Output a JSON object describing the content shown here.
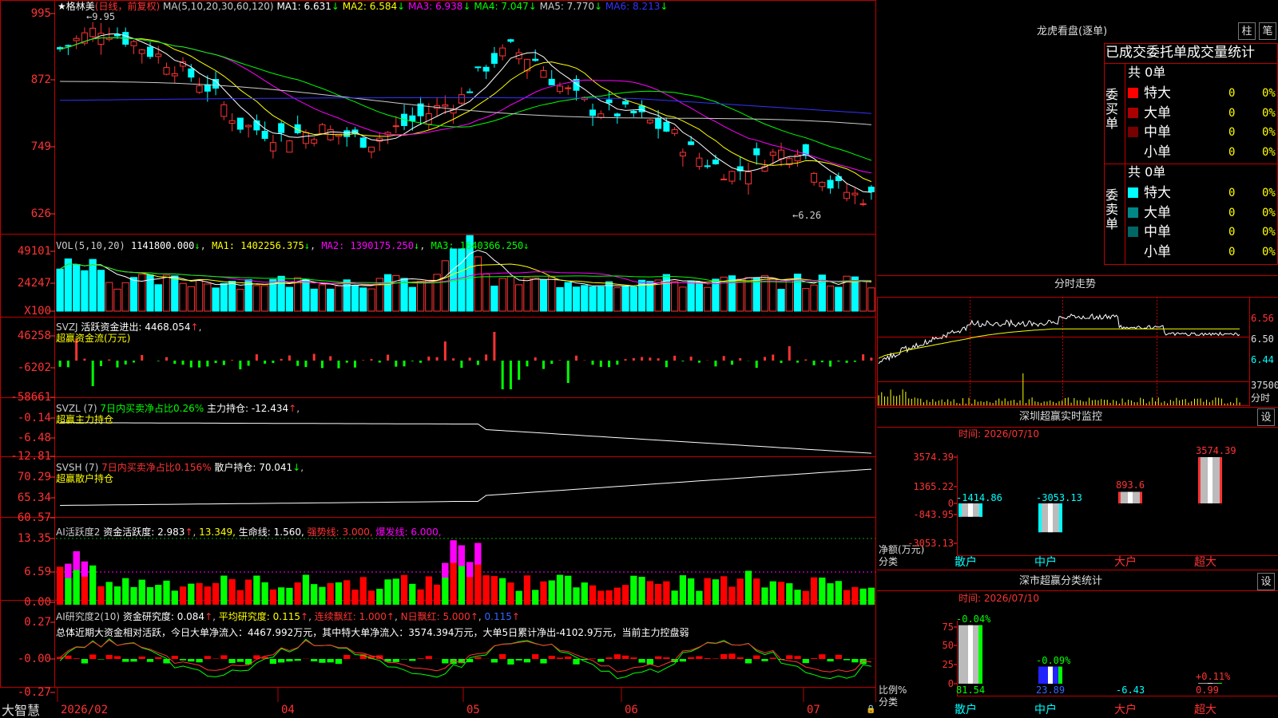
{
  "stock": {
    "name": "格林美",
    "star": "★",
    "period": "(日线，前复权)",
    "ma_params": "MA(5,10,20,30,60,120)",
    "ma": [
      {
        "label": "MA1:",
        "value": "6.631",
        "color": "#ffffff"
      },
      {
        "label": "MA2:",
        "value": "6.584",
        "color": "#ffff00"
      },
      {
        "label": "MA3:",
        "value": "6.938",
        "color": "#ff00ff"
      },
      {
        "label": "MA4:",
        "value": "7.047",
        "color": "#00ff00"
      },
      {
        "label": "MA5:",
        "value": "7.770",
        "color": "#cccccc"
      },
      {
        "label": "MA6:",
        "value": "8.213",
        "color": "#3333ff"
      }
    ],
    "high_mark": "9.95",
    "low_mark": "6.26"
  },
  "axes": {
    "price": [
      "995",
      "872",
      "749",
      "626"
    ],
    "vol": [
      "49101",
      "24247",
      "X100"
    ],
    "svzj": [
      "46258",
      "-6202",
      "-58661"
    ],
    "svzl": [
      "-0.14",
      "-6.48",
      "-12.81"
    ],
    "svsh": [
      "70.29",
      "65.34",
      "60.57"
    ],
    "ai": [
      "13.35",
      "6.59",
      "0.00"
    ],
    "ai2": [
      "0.27",
      "-0.00",
      "-0.27"
    ]
  },
  "vol_panel": {
    "title": "VOL(5,10,20)",
    "value": "1141800.000",
    "ma1": "MA1: 1402256.375",
    "ma2": "MA2: 1390175.250",
    "ma3": "MA3: 1640366.250"
  },
  "svzj_panel": {
    "title": "SVZJ",
    "label": "活跃资金进出: 4468.054",
    "sub": "超赢资金流(万元)"
  },
  "svzl_panel": {
    "title": "SVZL (7)",
    "label1": "7日内买卖净占比0.26%",
    "label2": "主力持仓: -12.434",
    "sub": "超赢主力持仓"
  },
  "svsh_panel": {
    "title": "SVSH (7)",
    "label1": "7日内买卖净占比0.156%",
    "label2": "散户持仓: 70.041",
    "sub": "超赢散户持仓"
  },
  "ai_panel": {
    "title": "AI活跃度2",
    "l1": "资金活跃度: 2.983",
    "l2": "13.349,",
    "l3": "生命线: 1.560,",
    "l4": "强势线: 3.000,",
    "l5": "爆发线: 6.000,"
  },
  "ai2_panel": {
    "title": "AI研究度2(10)",
    "l1": "资金研究度: 0.084",
    "l2": "平均研究度: 0.115",
    "l3": "连续飘红: 1.000",
    "l4": "N日飘红: 5.000",
    "l5": "0.115",
    "summary": "总体近期大资金相对活跃，今日大单净流入：4467.992万元，其中特大单净流入：3574.394万元，大单5日累计净出-4102.9万元，当前主力控盘弱"
  },
  "xaxis": {
    "brand": "大智慧",
    "labels": [
      "2026/02",
      "04",
      "05",
      "06",
      "07"
    ]
  },
  "dragon": {
    "title": "龙虎看盘(逐单)",
    "btn1": "柱",
    "btn2": "笔",
    "tabs": "已成交委托单成交量统计",
    "buy_label": "委买单",
    "sell_label": "委卖单",
    "buy_total": "共 0单",
    "sell_total": "共 0单",
    "rows_buy": [
      {
        "name": "特大",
        "v": "0",
        "p": "0%",
        "color": "#ff0000"
      },
      {
        "name": "大单",
        "v": "0",
        "p": "0%",
        "color": "#aa0000"
      },
      {
        "name": "中单",
        "v": "0",
        "p": "0%",
        "color": "#770000"
      },
      {
        "name": "小单",
        "v": "0",
        "p": "0%",
        "color": "#000000"
      }
    ],
    "rows_sell": [
      {
        "name": "特大",
        "v": "0",
        "p": "0%",
        "color": "#00ffff"
      },
      {
        "name": "大单",
        "v": "0",
        "p": "0%",
        "color": "#008888"
      },
      {
        "name": "中单",
        "v": "0",
        "p": "0%",
        "color": "#006666"
      },
      {
        "name": "小单",
        "v": "0",
        "p": "0%",
        "color": "#000000"
      }
    ]
  },
  "intraday": {
    "title": "分时走势",
    "p1": "6.56",
    "p2": "6.50",
    "p3": "6.44",
    "vol": "37500",
    "vol_label": "分时"
  },
  "monitor": {
    "title": "深圳超赢实时监控",
    "btn": "设",
    "time": "时间: 2026/07/10",
    "y": [
      "3574.39",
      "1365.22",
      "0",
      "-843.95",
      "-3053.13"
    ],
    "ylabel": "净额(万元)",
    "xlabel_title": "分类",
    "cats": [
      "散户",
      "中户",
      "大户",
      "超大"
    ],
    "values": [
      -1414.86,
      -3053.13,
      893.6,
      3574.39
    ],
    "labels": [
      "-1414.86",
      "-3053.13",
      "893.6",
      "3574.39"
    ]
  },
  "classify": {
    "title": "深市超赢分类统计",
    "btn": "设",
    "time": "时间: 2026/07/10",
    "y": [
      "75",
      "50",
      "25",
      "0"
    ],
    "ylabel": "比例%",
    "xlabel_title": "分类",
    "cats": [
      "散户",
      "中户",
      "大户",
      "超大"
    ],
    "bar_pct": [
      81.54,
      23.89,
      -6.43,
      0.99
    ],
    "pct_labels": [
      "81.54",
      "23.89",
      "-6.43",
      "0.99"
    ],
    "chg_labels": [
      "-0.04%",
      "-0.09%",
      "",
      "+0.11%"
    ]
  },
  "chart_data": [
    {
      "type": "candlestick",
      "title": "格林美(日线，前复权)",
      "ylim": [
        600,
        1000
      ],
      "y_ticks": [
        "995",
        "872",
        "749",
        "626"
      ],
      "x_labels": [
        "2026/02",
        "04",
        "05",
        "06",
        "07"
      ],
      "series": [
        {
          "name": "MA1",
          "last": 6.631
        },
        {
          "name": "MA2",
          "last": 6.584
        },
        {
          "name": "MA3",
          "last": 6.938
        },
        {
          "name": "MA4",
          "last": 7.047
        },
        {
          "name": "MA5",
          "last": 7.77
        },
        {
          "name": "MA6",
          "last": 8.213
        }
      ],
      "annotations": [
        "9.95",
        "6.26"
      ]
    },
    {
      "type": "bar",
      "title": "VOL(5,10,20)",
      "y_ticks": [
        "49101",
        "24247",
        "X100"
      ],
      "last": 1141800.0
    },
    {
      "type": "bar",
      "title": "SVZJ",
      "y_ticks": [
        "46258",
        "-6202",
        "-58661"
      ],
      "last": 4468.054
    },
    {
      "type": "line",
      "title": "SVZL (7)",
      "y_ticks": [
        "-0.14",
        "-6.48",
        "-12.81"
      ],
      "last": -12.434
    },
    {
      "type": "line",
      "title": "SVSH (7)",
      "y_ticks": [
        "70.29",
        "65.34",
        "60.57"
      ],
      "last": 70.041
    },
    {
      "type": "bar",
      "title": "AI活跃度2",
      "y_ticks": [
        "13.35",
        "6.59",
        "0.00"
      ],
      "last": 2.983
    },
    {
      "type": "bar",
      "title": "AI研究度2(10)",
      "y_ticks": [
        "0.27",
        "-0.00",
        "-0.27"
      ],
      "last": 0.084
    },
    {
      "type": "bar",
      "title": "深圳超赢实时监控",
      "categories": [
        "散户",
        "中户",
        "大户",
        "超大"
      ],
      "values": [
        -1414.86,
        -3053.13,
        893.6,
        3574.39
      ],
      "ylabel": "净额(万元)"
    },
    {
      "type": "bar",
      "title": "深市超赢分类统计",
      "categories": [
        "散户",
        "中户",
        "大户",
        "超大"
      ],
      "values": [
        81.54,
        23.89,
        -6.43,
        0.99
      ],
      "ylabel": "比例%"
    }
  ]
}
